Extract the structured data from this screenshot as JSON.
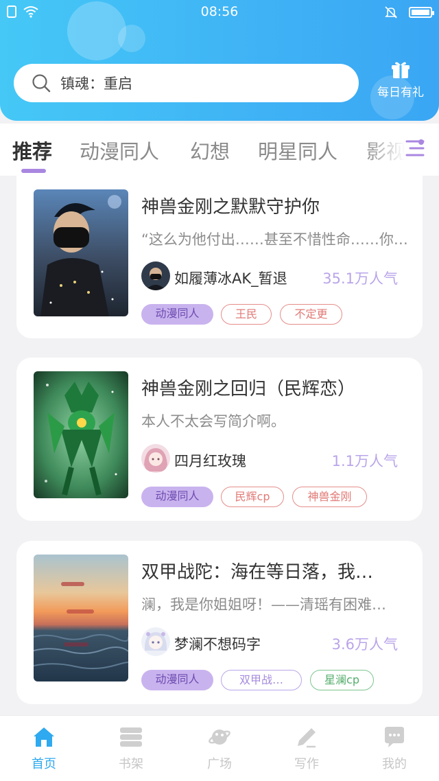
{
  "status": {
    "time": "08:56"
  },
  "search": {
    "text": "镇魂：重启"
  },
  "gift": {
    "label": "每日有礼"
  },
  "tabs": [
    {
      "label": "推荐"
    },
    {
      "label": "动漫同人"
    },
    {
      "label": "幻想"
    },
    {
      "label": "明星同人"
    },
    {
      "label": "影视"
    }
  ],
  "cards": [
    {
      "title": "神兽金刚之默默守护你",
      "desc": "“这么为他付出……甚至不惜性命……你…",
      "author": "如履薄冰AK_暂退",
      "popularity": "35.1万人气",
      "tags": [
        "动漫同人",
        "王民",
        "不定更"
      ]
    },
    {
      "title": "神兽金刚之回归（民辉恋）",
      "desc": "本人不太会写简介啊。",
      "author": "四月红玫瑰",
      "popularity": "1.1万人气",
      "tags": [
        "动漫同人",
        "民辉cp",
        "神兽金刚"
      ]
    },
    {
      "title": "双甲战陀：海在等日落，我…",
      "desc": "澜，我是你姐姐呀！——清瑶有困难…",
      "author": "梦澜不想码字",
      "popularity": "3.6万人气",
      "tags": [
        "动漫同人",
        "双甲战…",
        "星澜cp"
      ]
    }
  ],
  "nav": [
    {
      "label": "首页",
      "icon": "home-icon",
      "active": true
    },
    {
      "label": "书架",
      "icon": "bookshelf-icon"
    },
    {
      "label": "广场",
      "icon": "planet-icon"
    },
    {
      "label": "写作",
      "icon": "pen-icon"
    },
    {
      "label": "我的",
      "icon": "chat-bubble-icon"
    }
  ],
  "colors": {
    "header": "#3fb2f5",
    "accent": "#a987e0",
    "nav_active": "#2fa9ef"
  }
}
